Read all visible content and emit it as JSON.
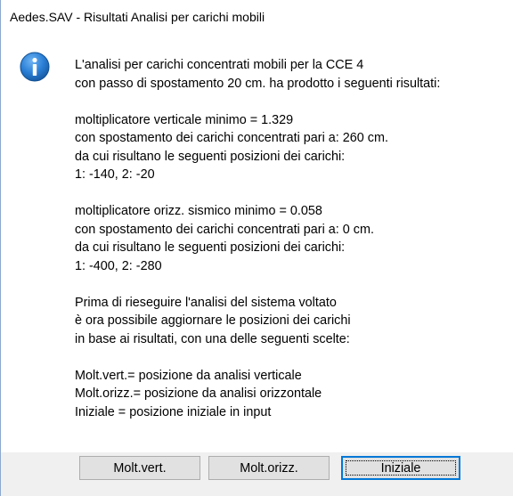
{
  "window": {
    "title": "Aedes.SAV - Risultati Analisi per carichi mobili"
  },
  "icon": {
    "name": "information-icon",
    "color": "#1d6fbf"
  },
  "message": {
    "paragraphs": [
      [
        "L'analisi per carichi concentrati mobili per la CCE 4",
        "con passo di spostamento 20 cm. ha prodotto i seguenti risultati:"
      ],
      [
        "moltiplicatore verticale minimo = 1.329",
        "con spostamento dei carichi concentrati pari a: 260 cm.",
        "da cui risultano le seguenti posizioni dei carichi:",
        "1: -140, 2: -20"
      ],
      [
        "moltiplicatore orizz. sismico minimo = 0.058",
        "con spostamento dei carichi concentrati pari a: 0 cm.",
        "da cui risultano le seguenti posizioni dei carichi:",
        "1: -400, 2: -280"
      ],
      [
        "Prima di rieseguire l'analisi del sistema voltato",
        "è ora possibile aggiornare le posizioni dei carichi",
        "in base ai risultati, con una delle seguenti scelte:"
      ],
      [
        "Molt.vert.= posizione da analisi verticale",
        "Molt.orizz.= posizione da analisi orizzontale",
        "Iniziale = posizione iniziale in input"
      ]
    ]
  },
  "buttons": {
    "molt_vert": "Molt.vert.",
    "molt_orizz": "Molt.orizz.",
    "iniziale": "Iniziale"
  }
}
